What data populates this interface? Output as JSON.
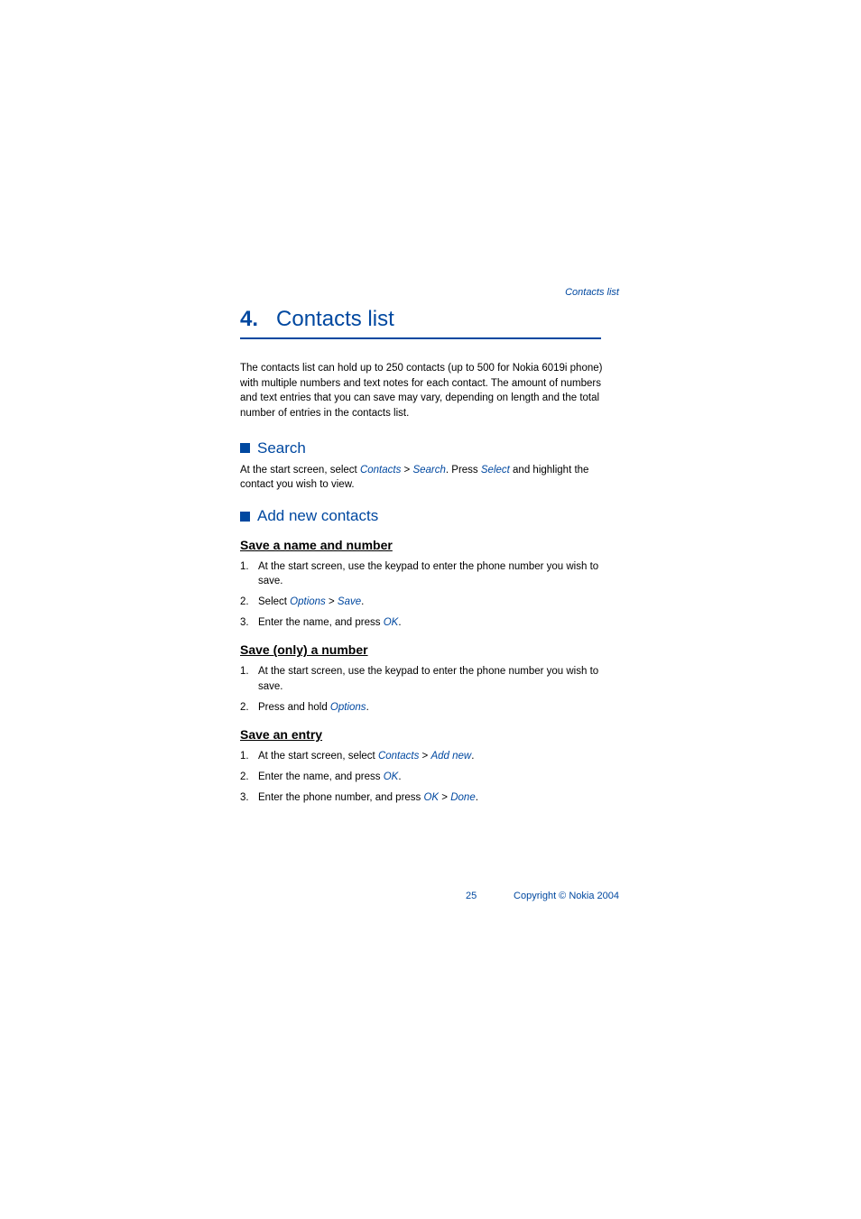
{
  "header": {
    "breadcrumb": "Contacts list"
  },
  "chapter": {
    "number": "4.",
    "title": "Contacts list"
  },
  "intro": "The contacts list can hold up to 250 contacts (up to 500 for Nokia 6019i phone) with multiple numbers and text notes for each contact. The amount of numbers and text entries that you can save may vary, depending on length and the total number of entries in the contacts list.",
  "sections": {
    "search": {
      "title": "Search",
      "body_prefix": "At the start screen, select ",
      "term_contacts": "Contacts",
      "sep1": " > ",
      "term_search": "Search",
      "body_mid": ". Press ",
      "term_select": "Select",
      "body_suffix": " and highlight the contact you wish to view."
    },
    "addnew": {
      "title": "Add new contacts"
    }
  },
  "subsections": {
    "saveNameNumber": {
      "title": "Save a name and number",
      "items": [
        {
          "num": "1.",
          "prefix": "At the start screen, use the keypad to enter the phone number you wish to save.",
          "terms": []
        },
        {
          "num": "2.",
          "prefix": "Select ",
          "t1": "Options",
          "sep": " > ",
          "t2": "Save",
          "suffix": "."
        },
        {
          "num": "3.",
          "prefix": "Enter the name, and press ",
          "t1": "OK",
          "suffix": "."
        }
      ]
    },
    "saveOnlyNumber": {
      "title": "Save (only) a number",
      "items": [
        {
          "num": "1.",
          "prefix": "At the start screen, use the keypad to enter the phone number you wish to save."
        },
        {
          "num": "2.",
          "prefix": "Press and hold ",
          "t1": "Options",
          "suffix": "."
        }
      ]
    },
    "saveEntry": {
      "title": "Save an entry",
      "items": [
        {
          "num": "1.",
          "prefix": "At the start screen, select ",
          "t1": "Contacts",
          "sep": " > ",
          "t2": "Add new",
          "suffix": "."
        },
        {
          "num": "2.",
          "prefix": "Enter the name, and press ",
          "t1": "OK",
          "suffix": "."
        },
        {
          "num": "3.",
          "prefix": "Enter the phone number, and press ",
          "t1": "OK",
          "sep": " > ",
          "t2": "Done",
          "suffix": "."
        }
      ]
    }
  },
  "footer": {
    "pageNumber": "25",
    "copyright": "Copyright © Nokia 2004"
  }
}
